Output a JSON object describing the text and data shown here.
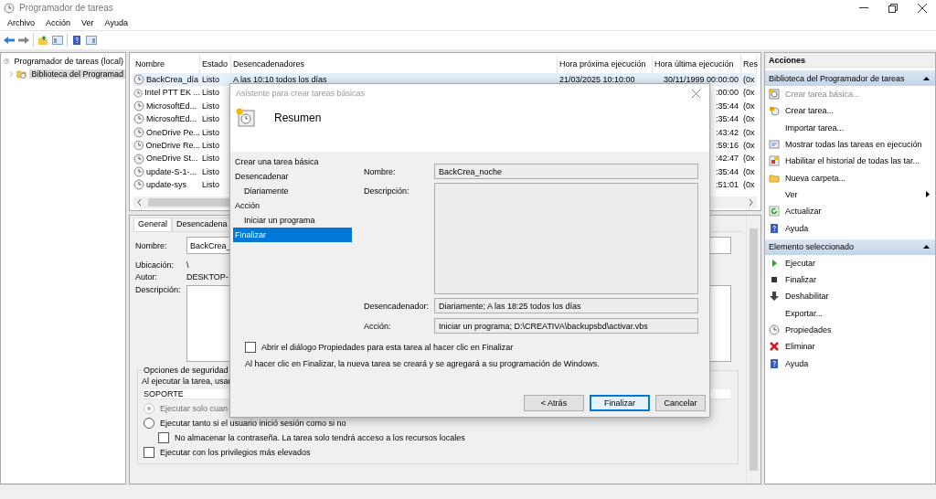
{
  "window": {
    "title": "Programador de tareas"
  },
  "menu": [
    "Archivo",
    "Acción",
    "Ver",
    "Ayuda"
  ],
  "tree": [
    {
      "label": "Programador de tareas (local)",
      "selected": false,
      "children": [
        {
          "label": "Biblioteca del Programad",
          "expanded": false,
          "selected": true
        }
      ]
    }
  ],
  "task_list": {
    "columns": [
      "Nombre",
      "Estado",
      "Desencadenadores",
      "Hora próxima ejecución",
      "Hora última ejecución",
      "Res"
    ],
    "rows": [
      {
        "cells": [
          "BackCrea_día",
          "Listo",
          "A las 10:10 todos los días",
          "21/03/2025 10:10:00",
          "30/11/1999 00:00:00",
          "(0x"
        ],
        "selected": true
      },
      {
        "cells": [
          "Intel PTT EK ...",
          "Listo",
          "",
          "",
          ":00:00",
          "(0x"
        ],
        "selected": false
      },
      {
        "cells": [
          "MicrosoftEd...",
          "Listo",
          "",
          "",
          ":35:44",
          "(0x"
        ],
        "selected": false
      },
      {
        "cells": [
          "MicrosoftEd...",
          "Listo",
          "",
          "",
          ":35:44",
          "(0x"
        ],
        "selected": false
      },
      {
        "cells": [
          "OneDrive Pe...",
          "Listo",
          "",
          "",
          ":43:42",
          "(0x"
        ],
        "selected": false
      },
      {
        "cells": [
          "OneDrive Re...",
          "Listo",
          "",
          "",
          ":59:16",
          "(0x"
        ],
        "selected": false
      },
      {
        "cells": [
          "OneDrive St...",
          "Listo",
          "",
          "",
          ":42:47",
          "(0x"
        ],
        "selected": false
      },
      {
        "cells": [
          "update-S-1-...",
          "Listo",
          "",
          "",
          ":35:44",
          "(0x"
        ],
        "selected": false
      },
      {
        "cells": [
          "update-sys",
          "Listo",
          "",
          "",
          ":51:01",
          "(0x"
        ],
        "selected": false
      }
    ]
  },
  "details": {
    "tabs": [
      {
        "label": "General",
        "selected": true
      },
      {
        "label": "Desencadena",
        "selected": false
      }
    ],
    "name_label": "Nombre:",
    "name_value": "BackCrea_",
    "location_label": "Ubicación:",
    "location_value": "\\",
    "author_label": "Autor:",
    "author_value": "DESKTOP-",
    "description_label": "Descripción:",
    "security": {
      "title": "Opciones de seguridad",
      "run_as_label": "Al ejecutar la tarea, usar",
      "user": "SOPORTE",
      "options": [
        {
          "kind": "radio",
          "label": "Ejecutar solo cuan",
          "checked": true,
          "disabled": true,
          "indented": false
        },
        {
          "kind": "radio",
          "label": "Ejecutar tanto si el usuario inició sesión como si no",
          "checked": false,
          "disabled": false,
          "indented": false
        },
        {
          "kind": "checkbox",
          "label": "No almacenar la contraseña. La tarea solo tendrá acceso a los recursos locales",
          "checked": false,
          "disabled": false,
          "indented": true
        },
        {
          "kind": "checkbox",
          "label": "Ejecutar con los privilegios más elevados",
          "checked": false,
          "disabled": false,
          "indented": false
        }
      ]
    }
  },
  "wizard": {
    "title": "Asistente para crear tareas básicas",
    "heading": "Resumen",
    "steps": [
      {
        "label": "Crear una tarea básica",
        "selected": false
      },
      {
        "label": "Desencadenar",
        "selected": false,
        "children": [
          {
            "label": "Diariamente",
            "selected": false
          }
        ]
      },
      {
        "label": "Acción",
        "selected": false,
        "children": [
          {
            "label": "Iniciar un programa",
            "selected": false
          }
        ]
      },
      {
        "label": "Finalizar",
        "selected": true
      }
    ],
    "name_label": "Nombre:",
    "name_value": "BackCrea_noche",
    "description_label": "Descripción:",
    "trigger_label": "Desencadenador:",
    "trigger_value": "Diariamente; A las 18:25 todos los días",
    "action_label": "Acción:",
    "action_value": "Iniciar un programa; D:\\CREATIVA\\backupsbd\\activar.vbs",
    "open_properties": {
      "label": "Abrir el diálogo Propiedades para esta tarea al hacer clic en Finalizar",
      "checked": false
    },
    "note": "Al hacer clic en Finalizar, la nueva tarea se creará y se agregará a su programación de Windows.",
    "buttons": [
      {
        "label": "< Atrás",
        "kind": "normal"
      },
      {
        "label": "Finalizar",
        "kind": "default"
      },
      {
        "label": "Cancelar",
        "kind": "normal"
      }
    ]
  },
  "actions": {
    "title": "Acciones",
    "sections": [
      {
        "title": "Biblioteca del Programador de tareas",
        "expanded": true,
        "items": [
          {
            "label": "Crear tarea básica...",
            "kind": "action",
            "disabled": true
          },
          {
            "label": "Crear tarea...",
            "kind": "action",
            "disabled": false
          },
          {
            "label": "Importar tarea...",
            "kind": "action",
            "disabled": false
          },
          {
            "label": "Mostrar todas las tareas en ejecución",
            "kind": "action",
            "disabled": false
          },
          {
            "label": "Habilitar el historial de todas las tar...",
            "kind": "action",
            "disabled": false
          },
          {
            "label": "Nueva carpeta...",
            "kind": "action",
            "disabled": false
          },
          {
            "label": "Ver",
            "kind": "submenu",
            "disabled": false
          },
          {
            "label": "Actualizar",
            "kind": "action",
            "disabled": false
          },
          {
            "label": "Ayuda",
            "kind": "action",
            "disabled": false
          }
        ]
      },
      {
        "title": "Elemento seleccionado",
        "expanded": true,
        "items": [
          {
            "label": "Ejecutar",
            "kind": "action",
            "disabled": false
          },
          {
            "label": "Finalizar",
            "kind": "action",
            "disabled": false
          },
          {
            "label": "Deshabilitar",
            "kind": "action",
            "disabled": false
          },
          {
            "label": "Exportar...",
            "kind": "action",
            "disabled": false
          },
          {
            "label": "Propiedades",
            "kind": "action",
            "disabled": false
          },
          {
            "label": "Eliminar",
            "kind": "action",
            "disabled": false
          },
          {
            "label": "Ayuda",
            "kind": "action",
            "disabled": false
          }
        ]
      }
    ]
  }
}
